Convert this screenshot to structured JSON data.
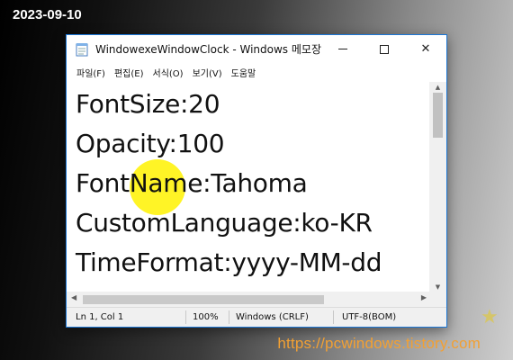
{
  "overlay": {
    "date": "2023-09-10",
    "site_url": "https://pcwindows.tistory.com"
  },
  "window": {
    "title": "WindowexeWindowClock - Windows 메모장",
    "app_icon": "notepad-icon",
    "controls": {
      "minimize": "—",
      "maximize": "☐",
      "close": "✕"
    }
  },
  "menu": [
    {
      "label": "파일(F)"
    },
    {
      "label": "편집(E)"
    },
    {
      "label": "서식(O)"
    },
    {
      "label": "보기(V)"
    },
    {
      "label": "도움말"
    }
  ],
  "editor": {
    "lines": [
      "FontSize:20",
      "Opacity:100",
      "FontName:Tahoma",
      "CustomLanguage:ko-KR",
      "TimeFormat:yyyy-MM-dd"
    ],
    "cursor_highlight_color": "#fff200"
  },
  "status": {
    "position": "Ln 1, Col 1",
    "zoom": "100%",
    "line_ending": "Windows (CRLF)",
    "encoding": "UTF-8(BOM)"
  },
  "colors": {
    "window_border": "#1c77d6",
    "url_color": "#f2a033"
  }
}
